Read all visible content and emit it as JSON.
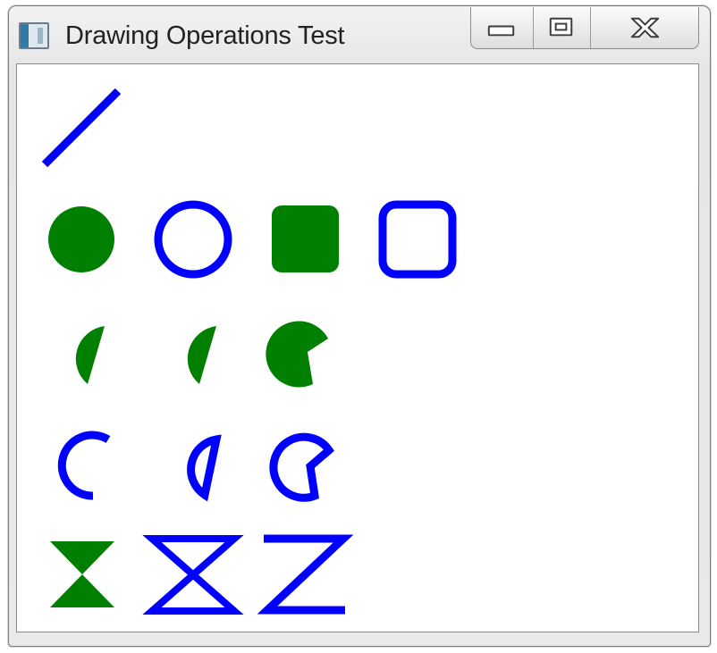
{
  "window": {
    "title": "Drawing Operations Test",
    "icon": "app-window-icon",
    "controls": [
      "minimize-icon",
      "maximize-icon",
      "close-icon"
    ]
  },
  "colors": {
    "fill": "#007f00",
    "stroke": "#0000ff",
    "client_background": "#ffffff"
  },
  "drawing": {
    "line": {
      "style": "stroke",
      "color": "#0000ff"
    },
    "row_ellipse_rect": [
      "filled-circle",
      "outlined-circle",
      "filled-rounded-rect",
      "outlined-rounded-rect"
    ],
    "row_filled_chords": [
      "filled-chord",
      "filled-chord",
      "filled-pie"
    ],
    "row_outlined_arcs": [
      "arc",
      "outlined-chord",
      "outlined-pie"
    ],
    "row_polygons": [
      "filled-hourglass",
      "outlined-hourglass",
      "z-polyline"
    ]
  }
}
